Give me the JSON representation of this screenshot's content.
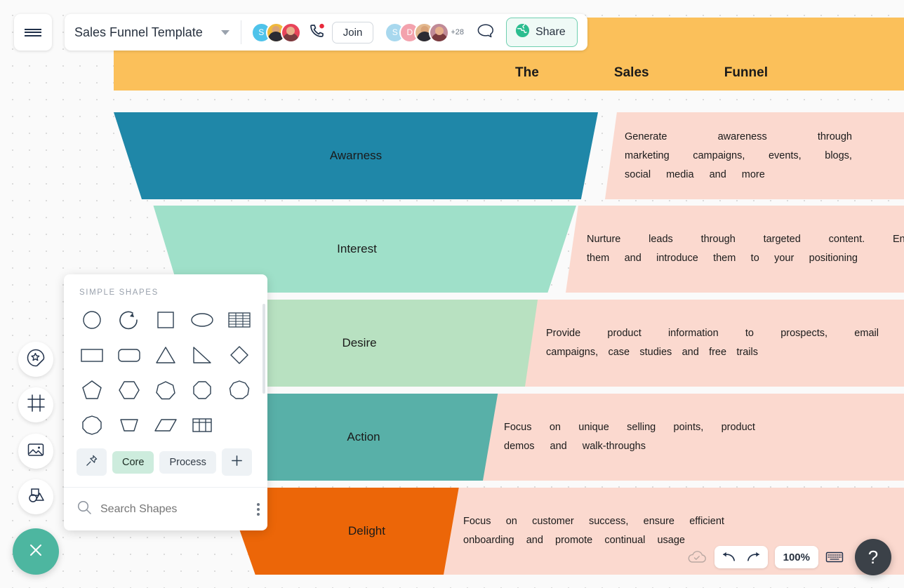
{
  "app": {
    "document_title": "Sales Funnel Template",
    "join_label": "Join",
    "share_label": "Share",
    "avatar_initials_1": "S",
    "avatar_group2_initial_1": "S",
    "avatar_group2_initial_2": "D",
    "extra_members": "+28"
  },
  "banner": {
    "words": [
      "The",
      "Sales",
      "Funnel"
    ]
  },
  "funnel": {
    "stages": [
      {
        "label": "Awarness",
        "color": "#1f87a8",
        "text_color": "#111111"
      },
      {
        "label": "Interest",
        "color": "#9fe0c9",
        "text_color": "#111111"
      },
      {
        "label": "Desire",
        "color": "#b8e1c1",
        "text_color": "#111111"
      },
      {
        "label": "Action",
        "color": "#58b0a8",
        "text_color": "#111111"
      },
      {
        "label": "Delight",
        "color": "#ec6608",
        "text_color": "#111111"
      }
    ],
    "descriptions": [
      {
        "lines": [
          [
            "Generate",
            "awareness",
            "through"
          ],
          [
            "marketing",
            "campaigns,",
            "events,",
            "blogs,"
          ],
          [
            "social",
            "media",
            "and",
            "more"
          ]
        ]
      },
      {
        "lines": [
          [
            "Nurture",
            "leads",
            "through",
            "targeted",
            "content.",
            "Engage"
          ],
          [
            "them",
            "and",
            "introduce",
            "them",
            "to",
            "your",
            "positioning"
          ]
        ]
      },
      {
        "lines": [
          [
            "Provide",
            "product",
            "information",
            "to",
            "prospects,",
            "email"
          ],
          [
            "campaigns,",
            "case",
            "studies",
            "and",
            "free",
            "trails"
          ]
        ]
      },
      {
        "lines": [
          [
            "Focus",
            "on",
            "unique",
            "selling",
            "points,",
            "product"
          ],
          [
            "demos",
            "and",
            "walk-throughs"
          ]
        ]
      },
      {
        "lines": [
          [
            "Focus",
            "on",
            "customer",
            "success,",
            "ensure",
            "efficient"
          ],
          [
            "onboarding",
            "and",
            "promote",
            "continual",
            "usage"
          ]
        ]
      }
    ],
    "panel_bg": "#fbd9cf"
  },
  "shapes_panel": {
    "heading": "SIMPLE SHAPES",
    "shapes": [
      "circle-shape",
      "arc-shape",
      "square-shape",
      "ellipse-shape",
      "table-lines-shape",
      "rectangle-shape",
      "rounded-rectangle-shape",
      "triangle-shape",
      "right-triangle-shape",
      "diamond-shape",
      "pentagon-shape",
      "hexagon-shape",
      "heptagon-shape",
      "octagon-shape",
      "nonagon-shape",
      "decagon-shape",
      "trapezoid-shape",
      "parallelogram-shape",
      "grid-table-shape"
    ],
    "tabs": [
      {
        "label": "",
        "icon": "pin-icon",
        "active": false
      },
      {
        "label": "Core",
        "icon": "",
        "active": true
      },
      {
        "label": "Process",
        "icon": "",
        "active": false
      },
      {
        "label": "",
        "icon": "plus-icon",
        "active": false
      }
    ],
    "search_placeholder": "Search Shapes"
  },
  "left_rail": {
    "items": [
      "shapes-sticker-icon",
      "frame-icon",
      "image-icon",
      "shape-objects-icon"
    ],
    "close_label": "close-icon"
  },
  "bottom_toolbar": {
    "zoom_level": "100%",
    "items": [
      "cloud-saved-icon",
      "undo-icon",
      "redo-icon",
      "keyboard-icon",
      "help-icon"
    ],
    "help_label": "?"
  }
}
